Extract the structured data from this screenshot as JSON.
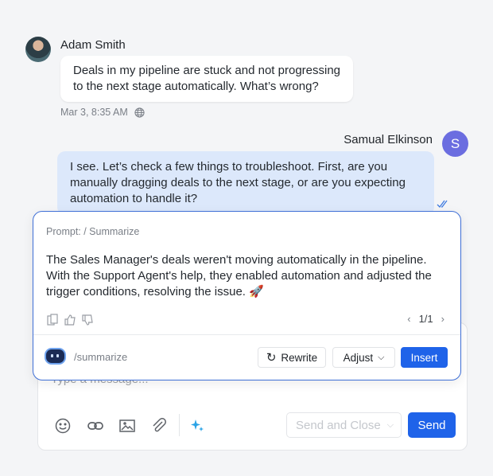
{
  "messages": [
    {
      "author": "Adam Smith",
      "text": "Deals in my pipeline are stuck and not progressing to the next stage automatically. What’s wrong?",
      "timestamp": "Mar 3, 8:35 AM",
      "icon": "globe-icon"
    },
    {
      "author": "Samual Elkinson",
      "avatar_initial": "S",
      "text": "I see. Let’s check a few things to troubleshoot. First, are you manually dragging deals to the next stage, or are you expecting automation to handle it?",
      "status_icon": "double-check-icon"
    }
  ],
  "ai_card": {
    "prompt": "Prompt: / Summarize",
    "summary": "The Sales Manager's deals weren't moving automatically in the pipeline. With the Support Agent's help, they enabled automation and adjusted the trigger conditions, resolving the issue. 🚀",
    "pager": "1/1",
    "command": "/summarize",
    "rewrite": "Rewrite",
    "adjust": "Adjust",
    "insert": "Insert"
  },
  "composer": {
    "placeholder": "Type a message...",
    "send_and_close": "Send and Close",
    "send": "Send"
  },
  "colors": {
    "accent": "#1f63e9",
    "agent_bubble": "#dce8fb",
    "avatar_s": "#6b6de0"
  }
}
